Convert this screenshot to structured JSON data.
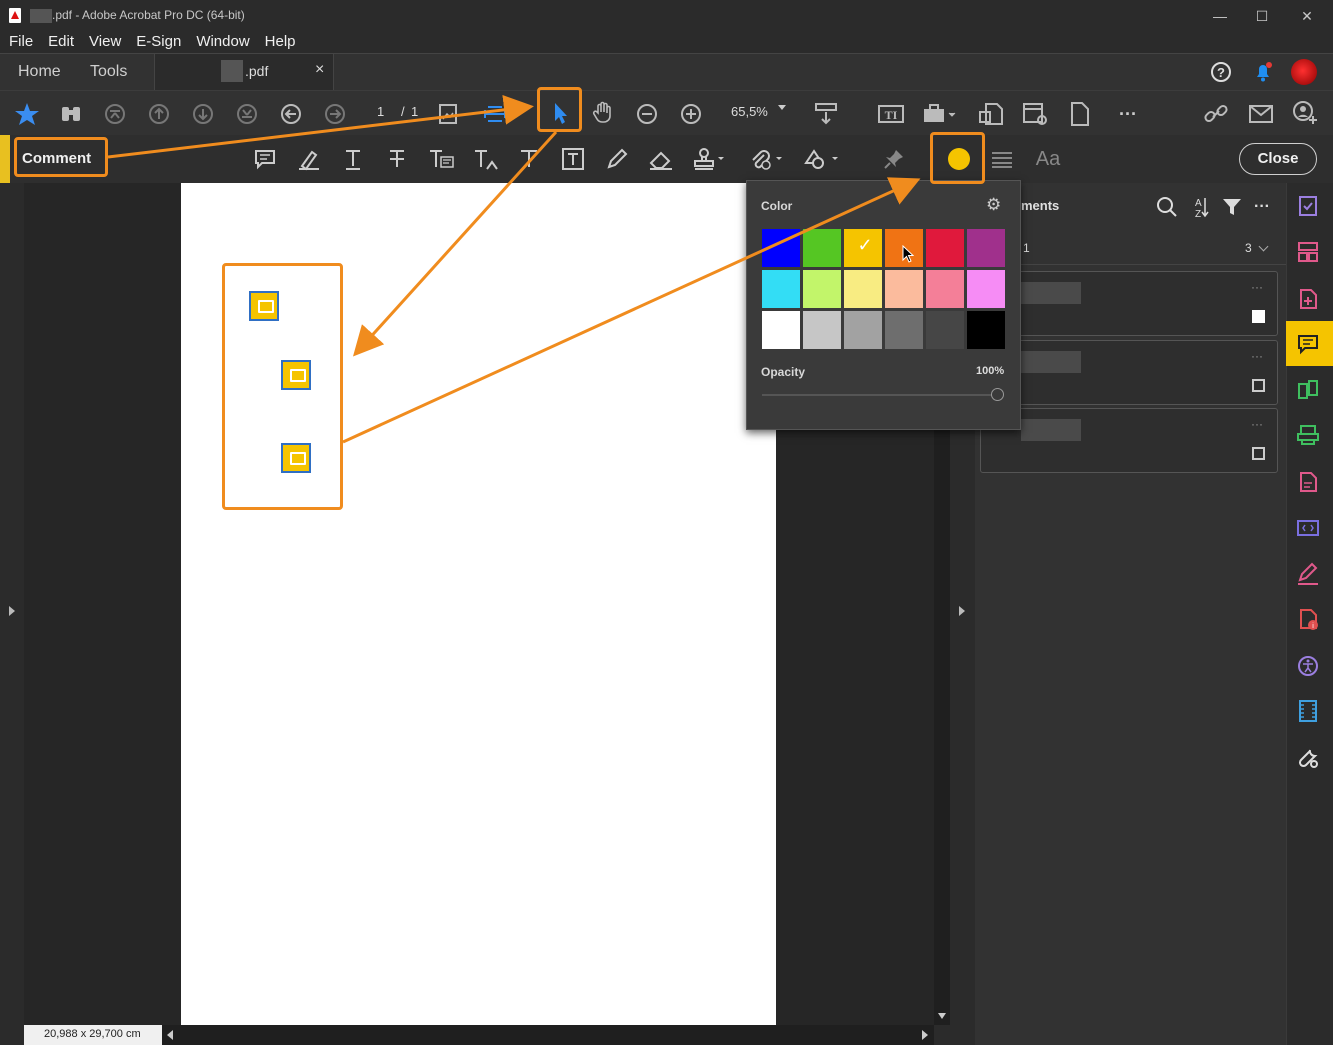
{
  "window": {
    "title": ".pdf - Adobe Acrobat Pro DC (64-bit)",
    "minimize": "—",
    "maximize": "☐",
    "close": "✕"
  },
  "menu": [
    "File",
    "Edit",
    "View",
    "E-Sign",
    "Window",
    "Help"
  ],
  "tabs": {
    "home": "Home",
    "tools": "Tools",
    "document": ".pdf",
    "close": "×"
  },
  "toolbar": {
    "page_current": "1",
    "page_sep": "/",
    "page_total": "1",
    "zoom": "65,5%"
  },
  "comment_toolbar": {
    "label": "Comment",
    "font_button": "Aa",
    "close_label": "Close",
    "active_color": "#f5c400"
  },
  "color_popover": {
    "title": "Color",
    "opacity_label": "Opacity",
    "opacity_value": "100%",
    "opacity": 1.0,
    "selected_color": "#f5c400",
    "swatches": [
      [
        "#0000ff",
        "#55c623",
        "#f5c400",
        "#f07314",
        "#e0193c",
        "#a0308c"
      ],
      [
        "#33ddf5",
        "#c2f56a",
        "#f8ec82",
        "#fbbb9d",
        "#f47f98",
        "#f68cf5"
      ],
      [
        "#ffffff",
        "#c6c6c6",
        "#a2a2a2",
        "#6e6e6e",
        "#464646",
        "#000000"
      ]
    ]
  },
  "comments_panel": {
    "title": "ments",
    "filter_page": "1",
    "count": "3",
    "card_menu": "···"
  },
  "status": {
    "page_size": "20,988 x 29,700 cm"
  },
  "colors": {
    "accent_orange": "#f08c1e",
    "note_yellow": "#f5c400",
    "note_border": "#2f6fc4"
  }
}
